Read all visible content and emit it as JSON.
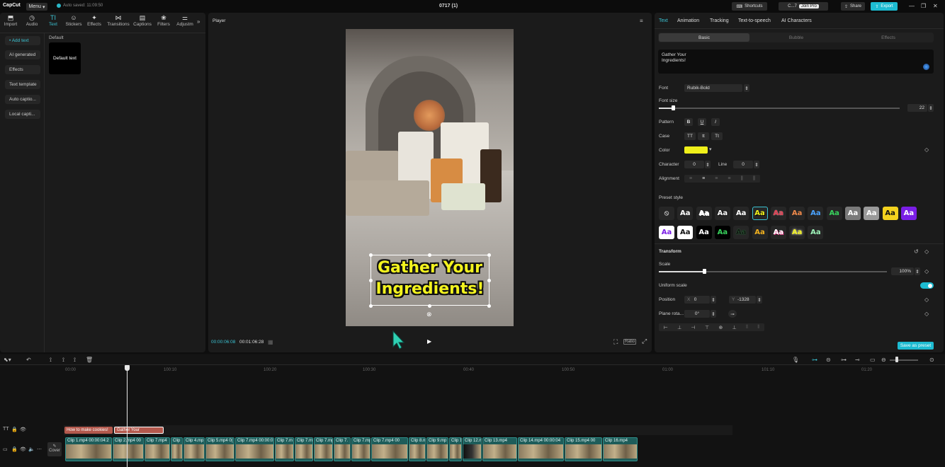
{
  "app": {
    "logo": "CapCut",
    "menu": "Menu",
    "autosave": "Auto saved: 11:09:50",
    "title": "0717 (1)"
  },
  "topbar": {
    "shortcuts": "Shortcuts",
    "user": "C...7",
    "join_pro": "Join Pro",
    "share": "Share",
    "export": "Export"
  },
  "toolbar": [
    {
      "label": "Import",
      "icon": "⬒"
    },
    {
      "label": "Audio",
      "icon": "◷"
    },
    {
      "label": "Text",
      "icon": "TI"
    },
    {
      "label": "Stickers",
      "icon": "☺"
    },
    {
      "label": "Effects",
      "icon": "✦"
    },
    {
      "label": "Transitions",
      "icon": "⋈"
    },
    {
      "label": "Captions",
      "icon": "▤"
    },
    {
      "label": "Filters",
      "icon": "❀"
    },
    {
      "label": "Adjustm",
      "icon": "⚌"
    }
  ],
  "left_side": {
    "items": [
      "• Add text",
      "AI generated",
      "Effects",
      "Text template",
      "Auto captio...",
      "Local capti..."
    ],
    "section": "Default",
    "card": "Default text"
  },
  "player": {
    "title": "Player",
    "caption_line1": "Gather Your",
    "caption_line2": "Ingredients!",
    "current_time": "00:00:06:08",
    "total_time": "00:01:06:28",
    "ratio": "Ratio"
  },
  "right": {
    "tabs": [
      "Text",
      "Animation",
      "Tracking",
      "Text-to-speech",
      "AI Characters"
    ],
    "segments": [
      "Basic",
      "Bubble",
      "Effects"
    ],
    "text_value_1": "Gather Your",
    "text_value_2": "Ingredients!",
    "font_label": "Font",
    "font_value": "Rubik-Bold",
    "font_size_label": "Font size",
    "font_size_value": "22",
    "pattern_label": "Pattern",
    "pattern_buttons": [
      "B",
      "U",
      "I"
    ],
    "case_label": "Case",
    "case_buttons": [
      "TT",
      "tt",
      "Tt"
    ],
    "color_label": "Color",
    "color_value": "#f0f01a",
    "character_label": "Character",
    "character_value": "0",
    "line_label": "Line",
    "line_value": "0",
    "alignment_label": "Alignment",
    "preset_label": "Preset style",
    "preset_glyph": "Aa",
    "transform_label": "Transform",
    "scale_label": "Scale",
    "scale_value": "100%",
    "uniform_label": "Uniform scale",
    "position_label": "Position",
    "pos_x_label": "X",
    "pos_x": "0",
    "pos_y_label": "Y",
    "pos_y": "-1328",
    "plane_label": "Plane rota...",
    "plane_value": "0°",
    "save_preset": "Save as preset"
  },
  "timeline": {
    "ruler": [
      "00:00",
      "100:10",
      "100:20",
      "100:30",
      "00:40",
      "100:50",
      "01:00",
      "101:10",
      "01:20"
    ],
    "text_clips": [
      "How to make cookies!",
      "Gather Your"
    ],
    "cover": "Cover",
    "clips": [
      "Clip 1.mp4  00:00:04:2",
      "Clip 2.mp4  00",
      "Clip 7.mp4",
      "Clip",
      "Clip 4.mp",
      "Clip 5.mp4  0(",
      "Clip 7.mp4  00:00:0",
      "Clip 7.m",
      "Clip 7.m",
      "Clip 7.mp4",
      "Clip 7.",
      "Clip 7.mp4",
      "Clip 7.mp4  00",
      "Clip 8.n",
      "Clip 9.mp",
      "Clip 1(",
      "Clip 12.n",
      "Clip 13.mp4",
      "Clip 14.mp4  00:00:04",
      "Clip 15.mp4  00",
      "Clip 16.mp4"
    ]
  }
}
